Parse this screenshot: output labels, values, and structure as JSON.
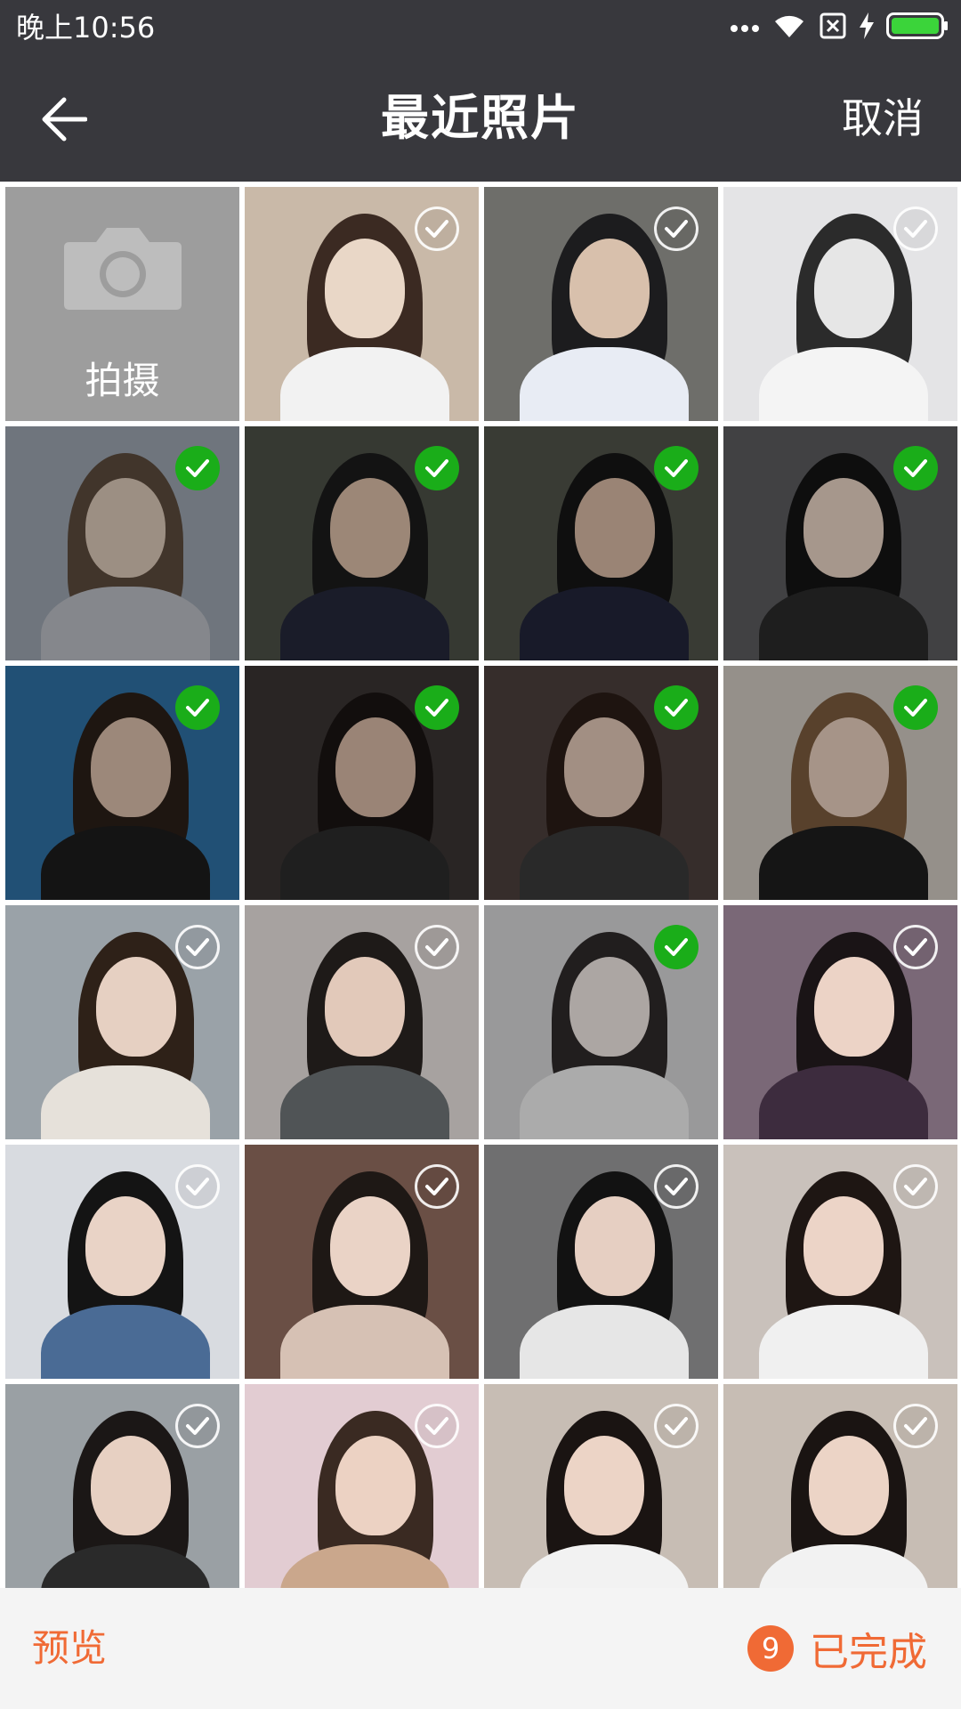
{
  "status_bar": {
    "time": "晚上10:56",
    "icons": [
      "more-dots-icon",
      "wifi-icon",
      "no-sim-icon",
      "charging-icon",
      "battery-icon"
    ]
  },
  "nav": {
    "title": "最近照片",
    "cancel_label": "取消",
    "back_icon": "back-arrow-icon"
  },
  "grid": {
    "camera_label": "拍摄",
    "photos": [
      {
        "selected": false
      },
      {
        "selected": false
      },
      {
        "selected": false
      },
      {
        "selected": true
      },
      {
        "selected": true
      },
      {
        "selected": true
      },
      {
        "selected": true
      },
      {
        "selected": true
      },
      {
        "selected": true
      },
      {
        "selected": true
      },
      {
        "selected": true
      },
      {
        "selected": false
      },
      {
        "selected": false
      },
      {
        "selected": true
      },
      {
        "selected": false
      },
      {
        "selected": false
      },
      {
        "selected": false
      },
      {
        "selected": false
      },
      {
        "selected": false
      },
      {
        "selected": false
      },
      {
        "selected": false
      },
      {
        "selected": false
      },
      {
        "selected": false
      }
    ]
  },
  "bottom": {
    "preview_label": "预览",
    "selected_count": "9",
    "done_label": "已完成"
  },
  "colors": {
    "bar_bg": "#38383d",
    "accent": "#f06a35",
    "check_green": "#1aad19",
    "bottom_bg": "#f4f4f4"
  }
}
